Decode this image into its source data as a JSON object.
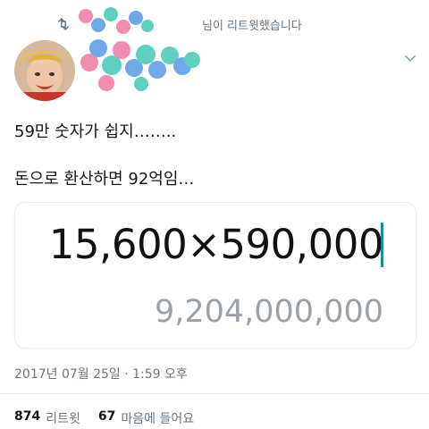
{
  "retweet": {
    "text": "님이 리트윗했습니다",
    "icon": "retweet-icon"
  },
  "author": {
    "avatar": "avatar",
    "more_icon": "chevron-down-icon"
  },
  "tweet": {
    "line1": "59만 숫자가 쉽지……..",
    "line2": "돈으로 환산하면 92억임…"
  },
  "calculator": {
    "expression": "15,600×590,000",
    "result": "9,204,000,000"
  },
  "meta": {
    "timestamp": "2017년 07월 25일 · 1:59 오후"
  },
  "stats": {
    "retweets_count": "874",
    "retweets_label": "리트윗",
    "likes_count": "67",
    "likes_label": "마음에 들어요"
  },
  "colors": {
    "accent_cursor": "#1b8e8e",
    "muted": "#657786"
  }
}
